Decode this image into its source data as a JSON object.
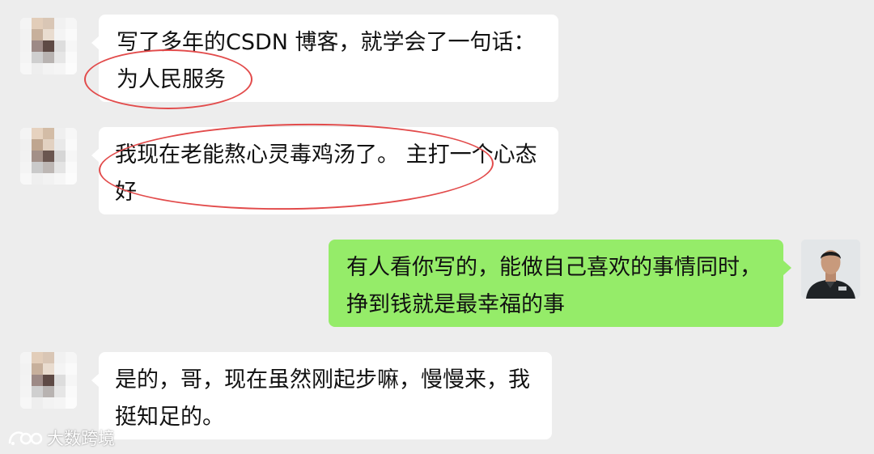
{
  "colors": {
    "chat_background": "#ededed",
    "incoming_bubble": "#ffffff",
    "outgoing_bubble": "#95ec69",
    "annotation_circle": "#e24b4b"
  },
  "messages": [
    {
      "sender": "contact",
      "avatar": "blurred-avatar",
      "lines": [
        "写了多年的CSDN 博客，就学会了一句话：",
        "为人民服务"
      ],
      "circled": true
    },
    {
      "sender": "contact",
      "avatar": "blurred-avatar",
      "lines": [
        "我现在老能熬心灵毒鸡汤了。 主打一个心态",
        "好"
      ],
      "circled": true
    },
    {
      "sender": "self",
      "avatar": "user-photo-avatar",
      "lines": [
        "有人看你写的，能做自己喜欢的事情同时，",
        "挣到钱就是最幸福的事"
      ],
      "circled": false
    },
    {
      "sender": "contact",
      "avatar": "blurred-avatar",
      "lines": [
        "是的，哥，现在虽然刚起步嘛，慢慢来，我",
        "挺知足的。"
      ],
      "circled": false
    }
  ],
  "watermark": {
    "icon": "eye-logo-icon",
    "text": "大数跨境"
  }
}
